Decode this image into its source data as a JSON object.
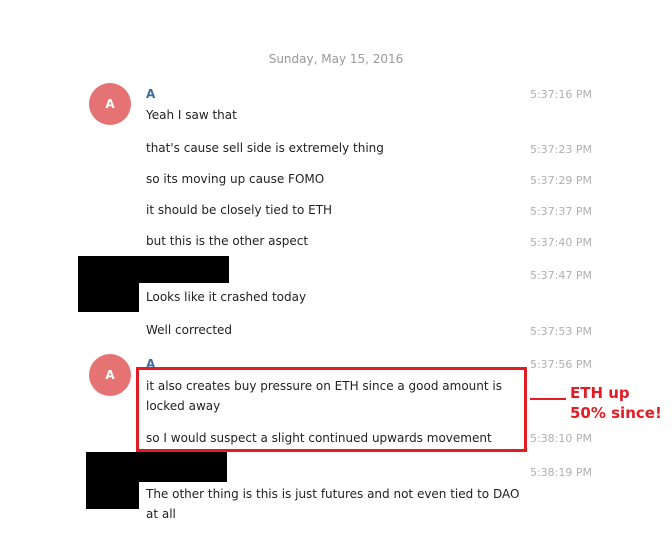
{
  "date_header": "Sunday, May 15, 2016",
  "avatar_letter": "A",
  "groups": [
    {
      "sender": "A",
      "messages": [
        {
          "text": "Yeah I saw that",
          "time": "5:37:16 PM"
        },
        {
          "text": "that's cause sell side is extremely thing",
          "time": "5:37:23 PM"
        },
        {
          "text": "so its moving up cause FOMO",
          "time": "5:37:29 PM"
        },
        {
          "text": "it should be closely tied to ETH",
          "time": "5:37:37 PM"
        },
        {
          "text": "but this is the other aspect",
          "time": "5:37:40 PM"
        }
      ]
    },
    {
      "sender": "",
      "redacted": true,
      "messages": [
        {
          "text": "Looks like it crashed today",
          "time": "5:37:47 PM"
        },
        {
          "text": "Well corrected",
          "time": "5:37:53 PM"
        }
      ]
    },
    {
      "sender": "A",
      "messages": [
        {
          "text": "it also creates buy pressure on ETH since a good amount is locked away",
          "time": "5:37:56 PM"
        },
        {
          "text": "so I would suspect a slight continued upwards movement",
          "time": "5:38:10 PM"
        }
      ]
    },
    {
      "sender": "",
      "redacted": true,
      "messages": [
        {
          "text": "The other thing is this is just futures and not even tied to DAO at all",
          "time": "5:38:19 PM"
        }
      ]
    }
  ],
  "annotation": {
    "text": "ETH up\n50% since!",
    "color": "#e31b23"
  },
  "colors": {
    "avatar_bg": "#e57373",
    "sender_name": "#3a6d99",
    "timestamp": "#b0b0b0"
  }
}
